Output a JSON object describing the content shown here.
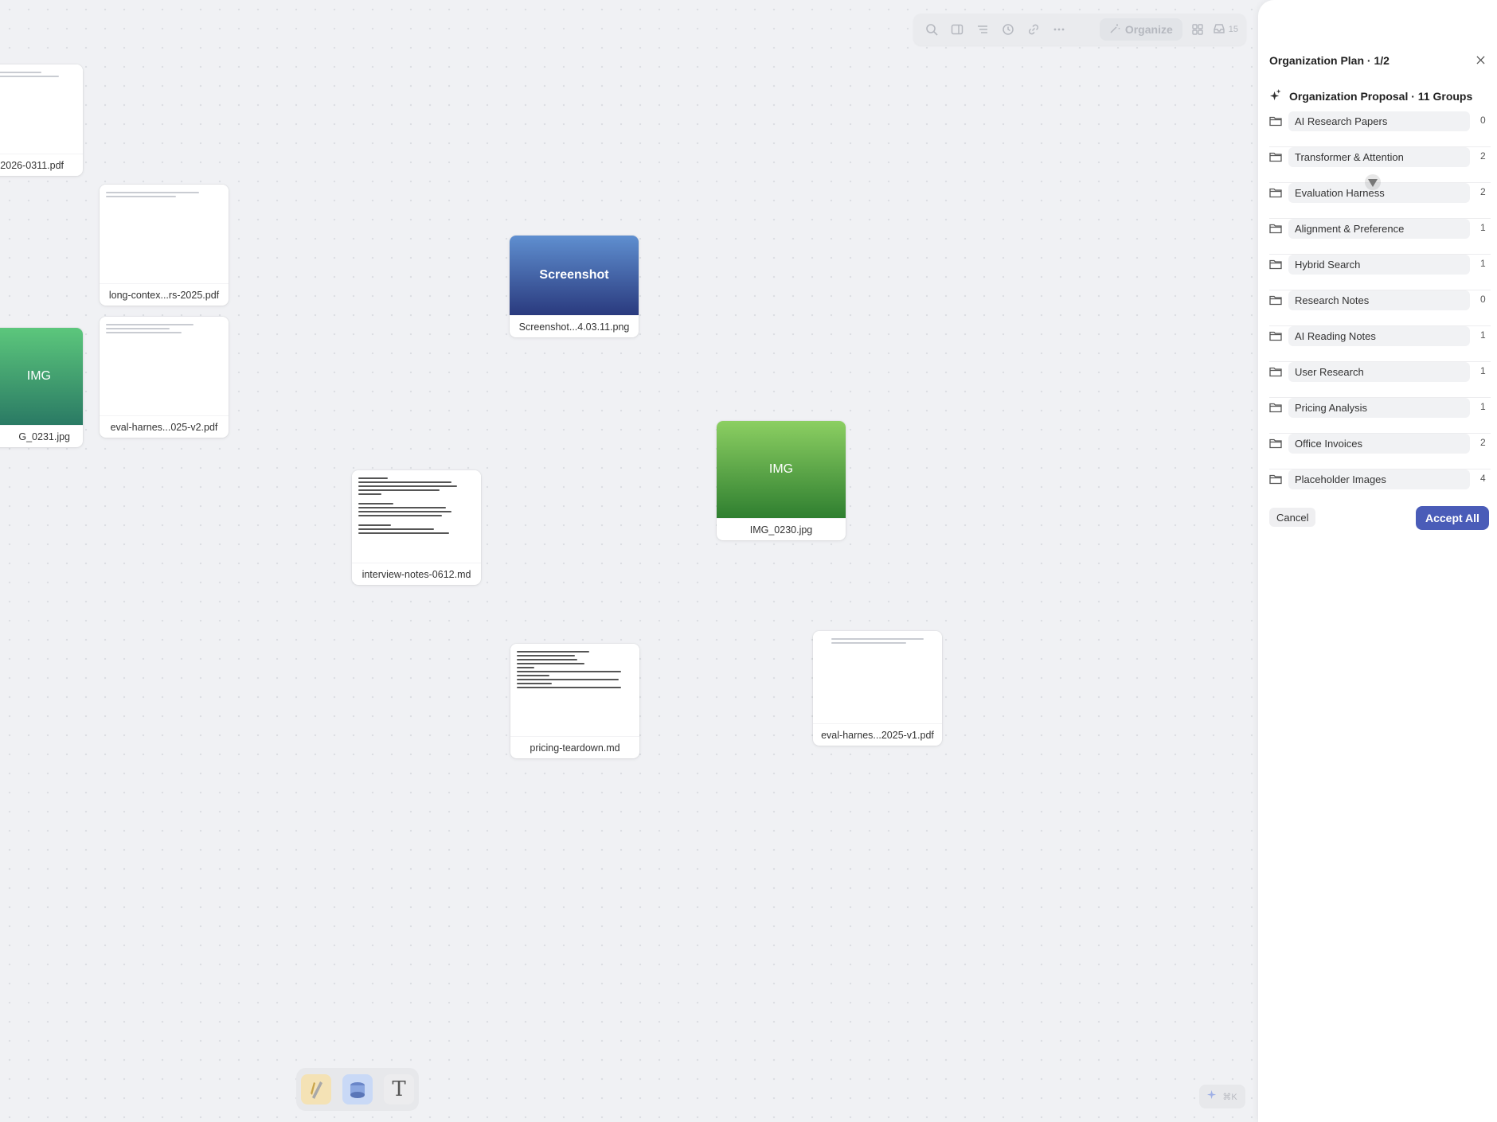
{
  "toolbar": {
    "icons": [
      "search-icon",
      "sidebar-icon",
      "list-icon",
      "history-icon",
      "link-icon",
      "more-icon"
    ],
    "organize_label": "Organize",
    "grid_icon": "grid-icon",
    "inbox_icon": "inbox-icon",
    "item_count": "15"
  },
  "canvas": {
    "cards": [
      {
        "id": "c1",
        "kind": "doc",
        "name": "2026-0311.pdf"
      },
      {
        "id": "c2",
        "kind": "doc",
        "name": "long-contex...rs-2025.pdf"
      },
      {
        "id": "c3",
        "kind": "doc",
        "name": "eval-harnes...025-v2.pdf"
      },
      {
        "id": "c4",
        "kind": "image",
        "label": "IMG",
        "name": "G_0231.jpg"
      },
      {
        "id": "c5",
        "kind": "image",
        "label": "Screenshot",
        "name": "Screenshot...4.03.11.png"
      },
      {
        "id": "c6",
        "kind": "image",
        "label": "IMG",
        "name": "IMG_0230.jpg"
      },
      {
        "id": "c7",
        "kind": "md",
        "name": "interview-notes-0612.md"
      },
      {
        "id": "c8",
        "kind": "md",
        "name": "pricing-teardown.md"
      },
      {
        "id": "c9",
        "kind": "doc",
        "name": "eval-harnes...2025-v1.pdf"
      }
    ]
  },
  "dock": {
    "tools": [
      "pen-tool-icon",
      "sticker-icon",
      "text-tool-icon"
    ],
    "text_tool_glyph": "T"
  },
  "command": {
    "shortcut": "⌘K",
    "icon": "sparkle-icon"
  },
  "panel": {
    "title": "Organization Plan · 1/2",
    "proposal_title": "Organization Proposal · 11 Groups",
    "groups": [
      {
        "name": "AI Research Papers",
        "count": "0"
      },
      {
        "name": "Transformer & Attention",
        "count": "2"
      },
      {
        "name": "Evaluation Harness",
        "count": "2"
      },
      {
        "name": "Alignment & Preference",
        "count": "1"
      },
      {
        "name": "Hybrid Search",
        "count": "1"
      },
      {
        "name": "Research Notes",
        "count": "0"
      },
      {
        "name": "AI Reading Notes",
        "count": "1"
      },
      {
        "name": "User Research",
        "count": "1"
      },
      {
        "name": "Pricing Analysis",
        "count": "1"
      },
      {
        "name": "Office Invoices",
        "count": "2"
      },
      {
        "name": "Placeholder Images",
        "count": "4"
      }
    ],
    "cancel_label": "Cancel",
    "accept_label": "Accept All"
  },
  "colors": {
    "accent": "#4a5cb8",
    "canvas_bg": "#f0f1f4",
    "screenshot_gradient": [
      "#5f8fd0",
      "#2a3a7e"
    ],
    "img_green_a": [
      "#5cc77c",
      "#2a7a64"
    ],
    "img_green_b": [
      "#8ccf62",
      "#2f7f30"
    ]
  }
}
